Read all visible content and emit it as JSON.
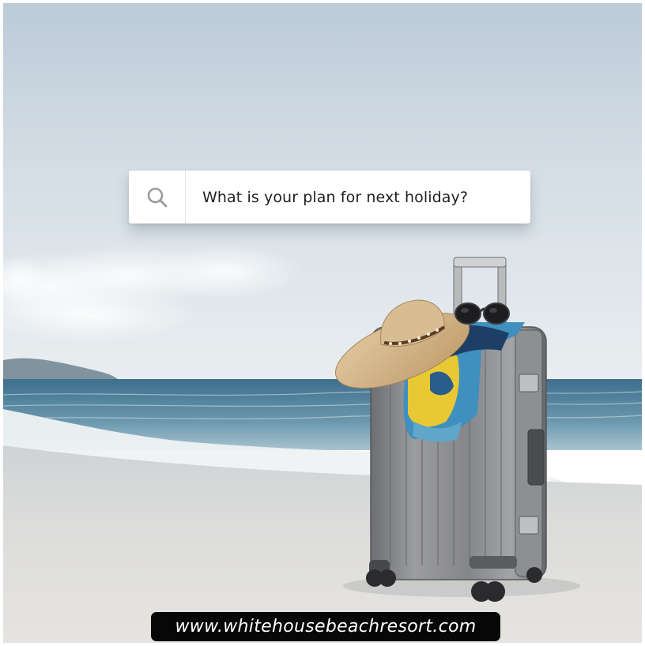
{
  "search": {
    "icon": "search-icon",
    "text": "What is your plan for next holiday?"
  },
  "banner": {
    "url": "www.whitehousebeachresort.com"
  },
  "colors": {
    "sky_top": "#bccbd8",
    "sea": "#4f7d9a",
    "sand": "#dcdcdb",
    "suitcase": "#8c8d8f",
    "hat": "#d6b78c",
    "banner_bg": "#070707"
  }
}
